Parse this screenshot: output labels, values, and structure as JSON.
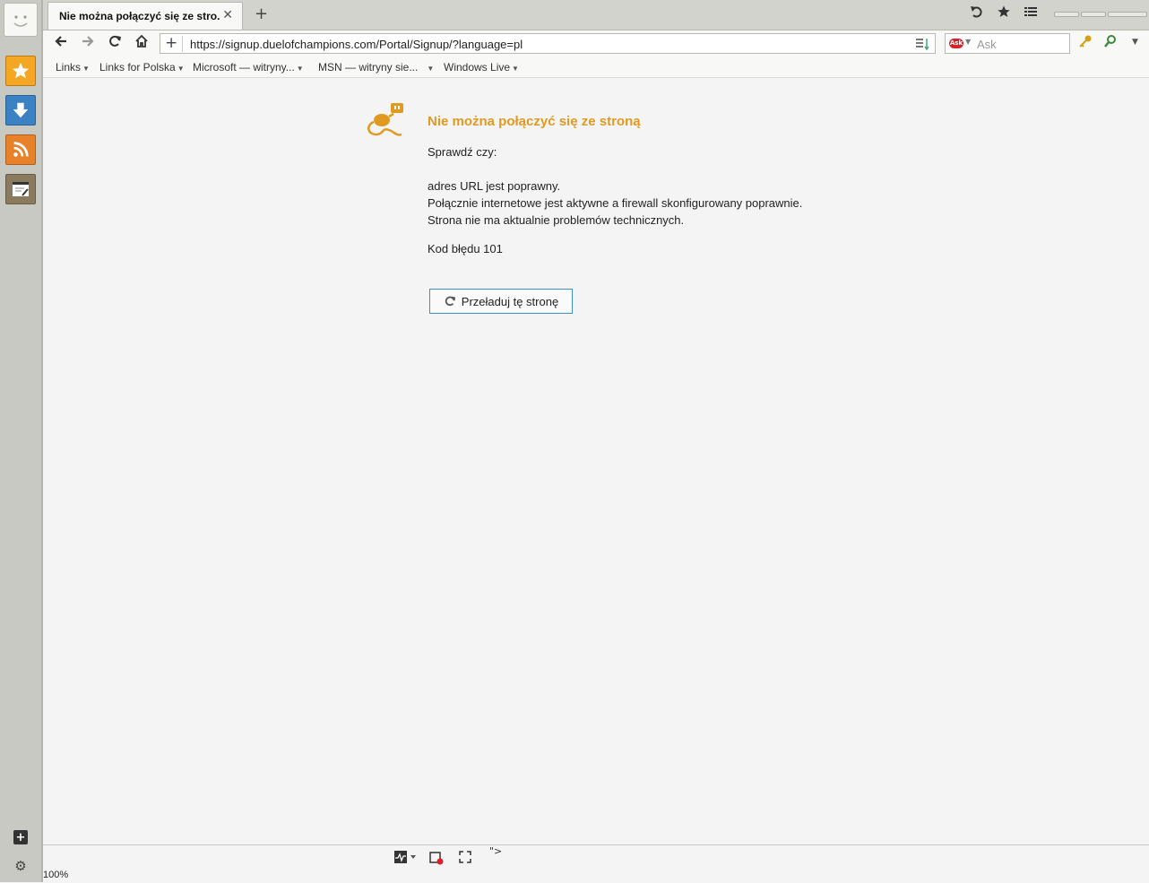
{
  "tab": {
    "title": "Nie można połączyć się ze stro...",
    "close": "✕",
    "new_tab": "+"
  },
  "nav": {
    "url": "https://signup.duelofchampions.com/Portal/Signup/?language=pl",
    "url_add": "+"
  },
  "search": {
    "placeholder": "Ask",
    "engine_logo": "Ask"
  },
  "bookmarks": [
    {
      "label": "Links"
    },
    {
      "label": "Links for Polska"
    },
    {
      "label": "Microsoft — witryny..."
    },
    {
      "label": "MSN — witryny sie..."
    },
    {
      "label": "Windows Live"
    }
  ],
  "error": {
    "title": "Nie można połączyć się ze stroną",
    "check": "Sprawdź czy:",
    "line1": "adres URL jest poprawny.",
    "line2": "Połącznie internetowe jest aktywne a firewall skonfigurowany poprawnie.",
    "line3": "Strona nie ma aktualnie problemów technicznych.",
    "code": "Kod błędu 101",
    "reload": "Przeładuj tę stronę"
  },
  "status": {
    "zoom": "100%",
    "quote": "\">"
  },
  "sidebar": {
    "add": "+",
    "settings": "⚙"
  },
  "icons": {
    "undo": "undo-icon",
    "star": "star-icon",
    "menu": "menu-icon",
    "back": "back-icon",
    "forward": "forward-icon",
    "reload": "reload-icon",
    "home": "home-icon",
    "bookmarks_panel": "star-panel-icon",
    "downloads_panel": "download-icon",
    "feeds_panel": "rss-icon",
    "notes_panel": "notes-icon"
  },
  "colors": {
    "accent_orange": "#e09a22",
    "button_border": "#3d8ed6",
    "sidebar_star": "#f5a623",
    "sidebar_download": "#3b82c4",
    "sidebar_rss": "#e8822a"
  }
}
